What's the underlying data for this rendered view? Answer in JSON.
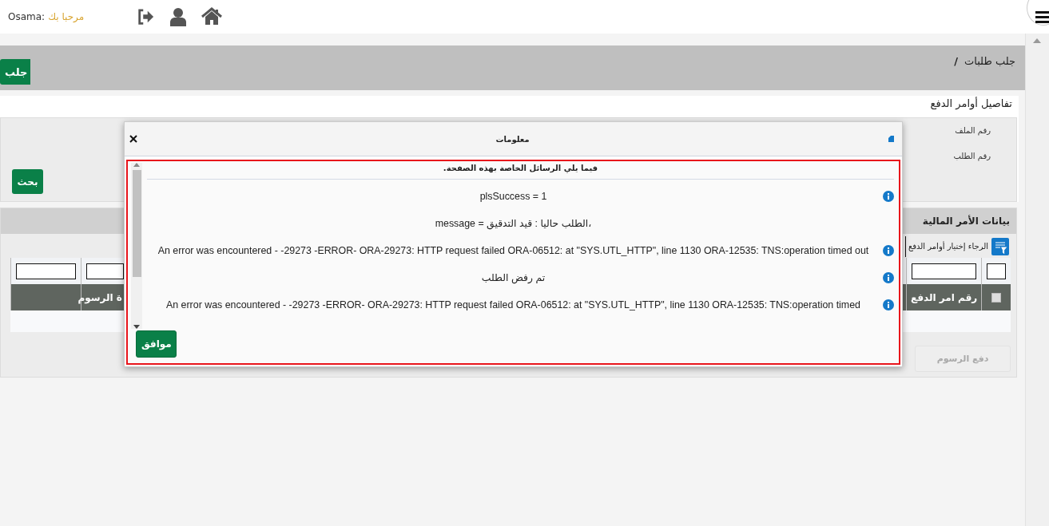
{
  "header": {
    "user": "Osama:",
    "greeting": "مرحبا بك"
  },
  "breadcrumb": {
    "title": "جلب طلبات",
    "separator": "/",
    "button": "جلب"
  },
  "details": {
    "title": "تفاصيل أوامر الدفع",
    "fields": [
      {
        "label": "رقم الملف"
      },
      {
        "label": "رقم الطلب"
      }
    ],
    "search_button": "بحث"
  },
  "grid": {
    "title": "بيانات الأمر المالية",
    "hint": "الرجاء إختيار أوامر الدفع",
    "columns": [
      {
        "kind": "checkbox",
        "checked": false
      },
      {
        "kind": "text",
        "label": "رقم امر الدفع"
      },
      {
        "kind": "text",
        "label": "ة الرسوم"
      },
      {
        "kind": "blank"
      }
    ],
    "pay_button": {
      "label": "دفع الرسوم",
      "disabled": true
    }
  },
  "dialog": {
    "title": "معلومات",
    "intro": "فيما يلي الرسائل الخاصة بهذه الصفحة.",
    "messages": [
      {
        "kind": "info",
        "text": "plsSuccess = 1"
      },
      {
        "kind": "plain",
        "text": "message = الطلب حاليا : قيد التدقيق،"
      },
      {
        "kind": "info",
        "text": "An error was encountered - -29273 -ERROR- ORA-29273: HTTP request failed ORA-06512: at \"SYS.UTL_HTTP\", line 1130 ORA-12535: TNS:operation timed out"
      },
      {
        "kind": "info",
        "text": "تم رفض الطلب"
      },
      {
        "kind": "info",
        "text": "An error was encountered - -29273 -ERROR- ORA-29273: HTTP request failed ORA-06512: at \"SYS.UTL_HTTP\", line 1130 ORA-12535: TNS:operation timed"
      }
    ],
    "ok_button": "موافق"
  }
}
